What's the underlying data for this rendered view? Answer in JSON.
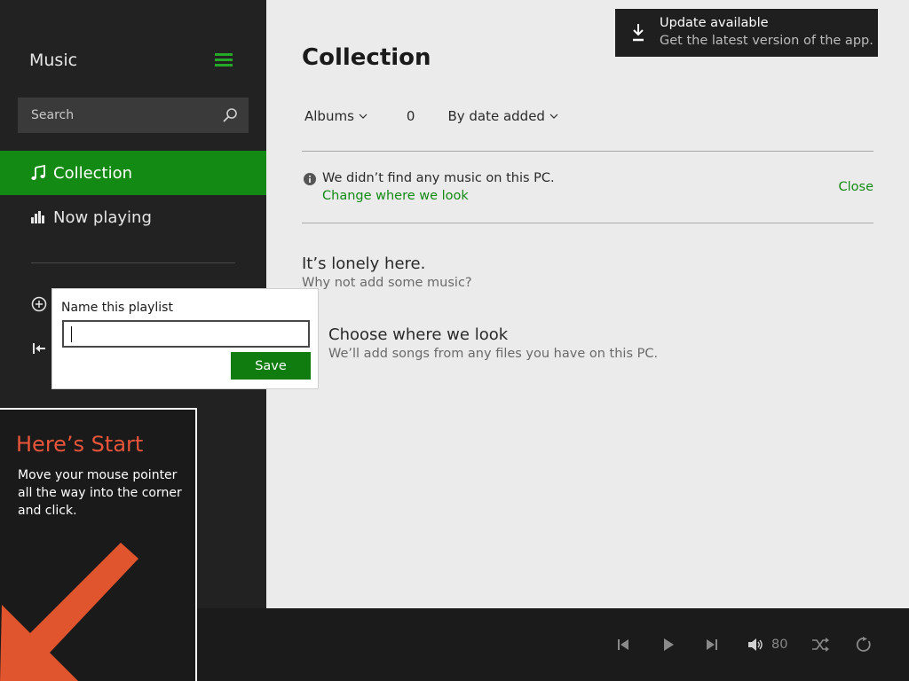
{
  "app": {
    "title": "Music"
  },
  "sidebar": {
    "search_placeholder": "Search",
    "items": [
      {
        "label": "Collection",
        "icon": "music-note-icon",
        "selected": true
      },
      {
        "label": "Now playing",
        "icon": "bar-chart-icon",
        "selected": false
      }
    ]
  },
  "playlist_popup": {
    "label": "Name this playlist",
    "input_value": "",
    "save_label": "Save"
  },
  "main": {
    "title": "Collection",
    "filter": {
      "view": "Albums",
      "count": "0",
      "sort": "By date added"
    },
    "notice": {
      "text": "We didn’t find any music on this PC.",
      "link": "Change where we look",
      "close": "Close"
    },
    "empty": {
      "heading": "It’s lonely here.",
      "subheading": "Why not add some music?",
      "action_heading": "Choose where we look",
      "action_sub": "We’ll add songs from any files you have on this PC."
    }
  },
  "update_toast": {
    "title": "Update available",
    "subtitle": "Get the latest version of the app."
  },
  "player": {
    "volume": "80"
  },
  "start_tip": {
    "title": "Here’s Start",
    "body": "Move your mouse pointer all the way into the corner and click."
  },
  "colors": {
    "accent": "#138a13",
    "sidebar_bg": "#222222",
    "main_bg": "#ebebeb",
    "tip_title": "#e8553a",
    "tip_arrow": "#e0542e"
  }
}
